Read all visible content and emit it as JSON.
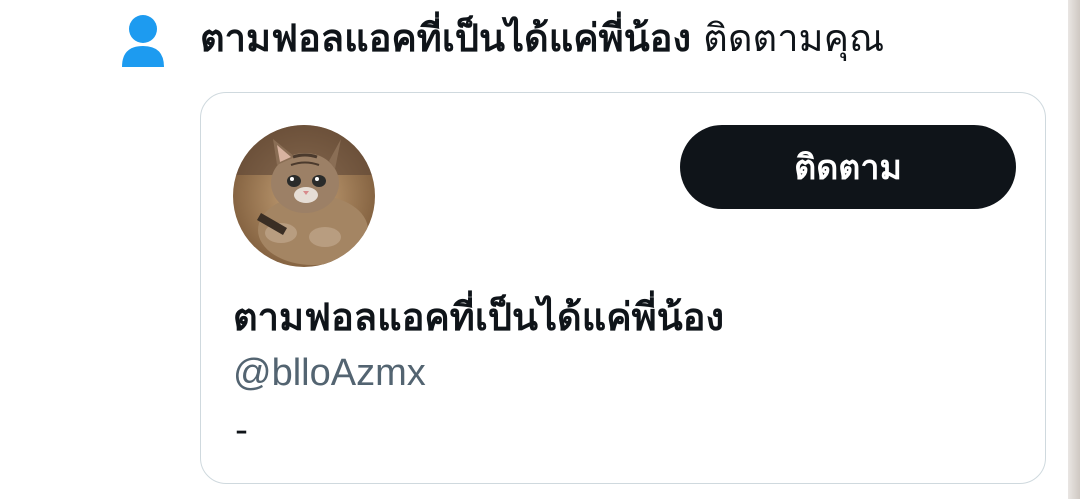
{
  "notification": {
    "icon": "person-icon",
    "icon_color": "#1d9bf0",
    "name": "ตามฟอลแอคที่เป็นได้แค่พี่น้อง",
    "action": "ติดตามคุณ"
  },
  "profile_card": {
    "avatar": "cat-avatar",
    "follow_label": "ติดตาม",
    "display_name": "ตามฟอลแอคที่เป็นได้แค่พี่น้อง",
    "handle": "@blloAzmx",
    "bio": "-"
  },
  "colors": {
    "text_primary": "#0f1419",
    "text_secondary": "#536471",
    "button_bg": "#0f1419",
    "button_text": "#ffffff",
    "card_border": "#cfd9de"
  }
}
